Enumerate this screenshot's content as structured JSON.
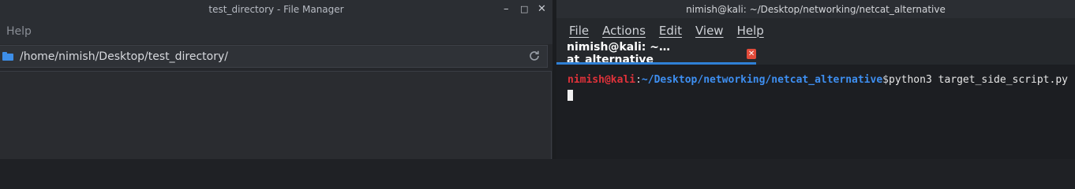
{
  "file_manager": {
    "window_title": "test_directory - File Manager",
    "controls": {
      "minimize": "–",
      "maximize": "□",
      "close": "✕"
    },
    "menu": {
      "help": "Help"
    },
    "path": "/home/nimish/Desktop/test_directory/",
    "icons": {
      "folder": "folder-icon",
      "reload": "reload-icon"
    }
  },
  "terminal": {
    "window_title": "nimish@kali: ~/Desktop/networking/netcat_alternative",
    "menu": [
      "File",
      "Actions",
      "Edit",
      "View",
      "Help"
    ],
    "tab": {
      "label": "nimish@kali: ~…at_alternative",
      "close": "✕"
    },
    "prompt": {
      "user_host": "nimish@kali",
      "separator": ":",
      "path": "~/Desktop/networking/netcat_alternative",
      "symbol": "$",
      "command": " python3 target_side_script.py"
    },
    "colors": {
      "user": "#e0323a",
      "path": "#3e8ff1",
      "tab_underline": "#2f80d6",
      "tab_close": "#e14b3a"
    }
  }
}
